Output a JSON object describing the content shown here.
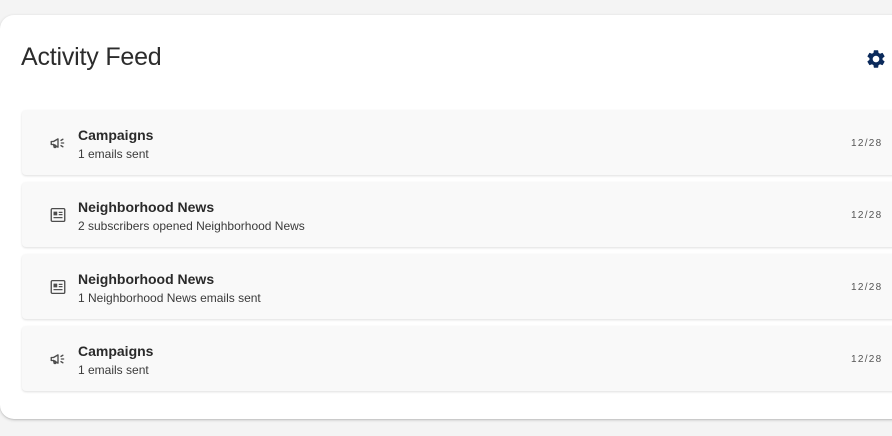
{
  "feed": {
    "title": "Activity Feed",
    "settings_icon": "gear-icon",
    "accent_color": "#0b2a5b",
    "items": [
      {
        "icon": "megaphone-icon",
        "title": "Campaigns",
        "subtitle": "1 emails sent",
        "date": "12/28"
      },
      {
        "icon": "newspaper-icon",
        "title": "Neighborhood News",
        "subtitle": "2 subscribers opened Neighborhood News",
        "date": "12/28"
      },
      {
        "icon": "newspaper-icon",
        "title": "Neighborhood News",
        "subtitle": "1 Neighborhood News emails sent",
        "date": "12/28"
      },
      {
        "icon": "megaphone-icon",
        "title": "Campaigns",
        "subtitle": "1 emails sent",
        "date": "12/28"
      }
    ]
  }
}
